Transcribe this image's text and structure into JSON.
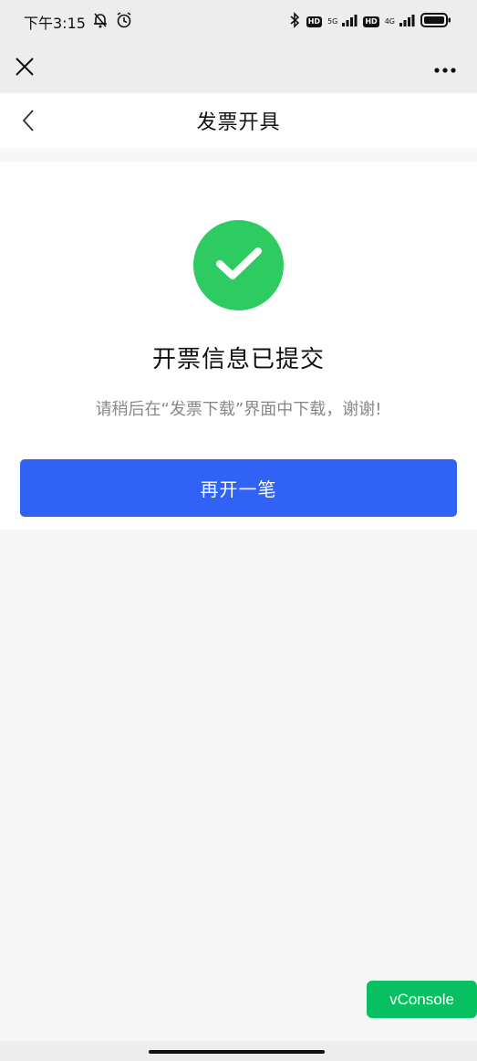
{
  "status_bar": {
    "time": "下午3:15",
    "signal_5g": "5G",
    "signal_4g": "4G",
    "hd_label": "HD",
    "icons": [
      "notification-off-icon",
      "alarm-icon",
      "bluetooth-icon",
      "signal-icon",
      "battery-icon"
    ]
  },
  "webview": {
    "close_icon": "close-icon",
    "more_icon": "more-icon"
  },
  "header": {
    "title": "发票开具",
    "back_icon": "chevron-left-icon"
  },
  "result": {
    "title": "开票信息已提交",
    "description": "请稍后在“发票下载”界面中下载，谢谢!",
    "icon": "check-icon",
    "icon_color": "#2dcb62"
  },
  "actions": {
    "again_label": "再开一笔",
    "primary_color": "#2f62f5"
  },
  "vconsole": {
    "label": "vConsole",
    "color": "#07c160"
  }
}
